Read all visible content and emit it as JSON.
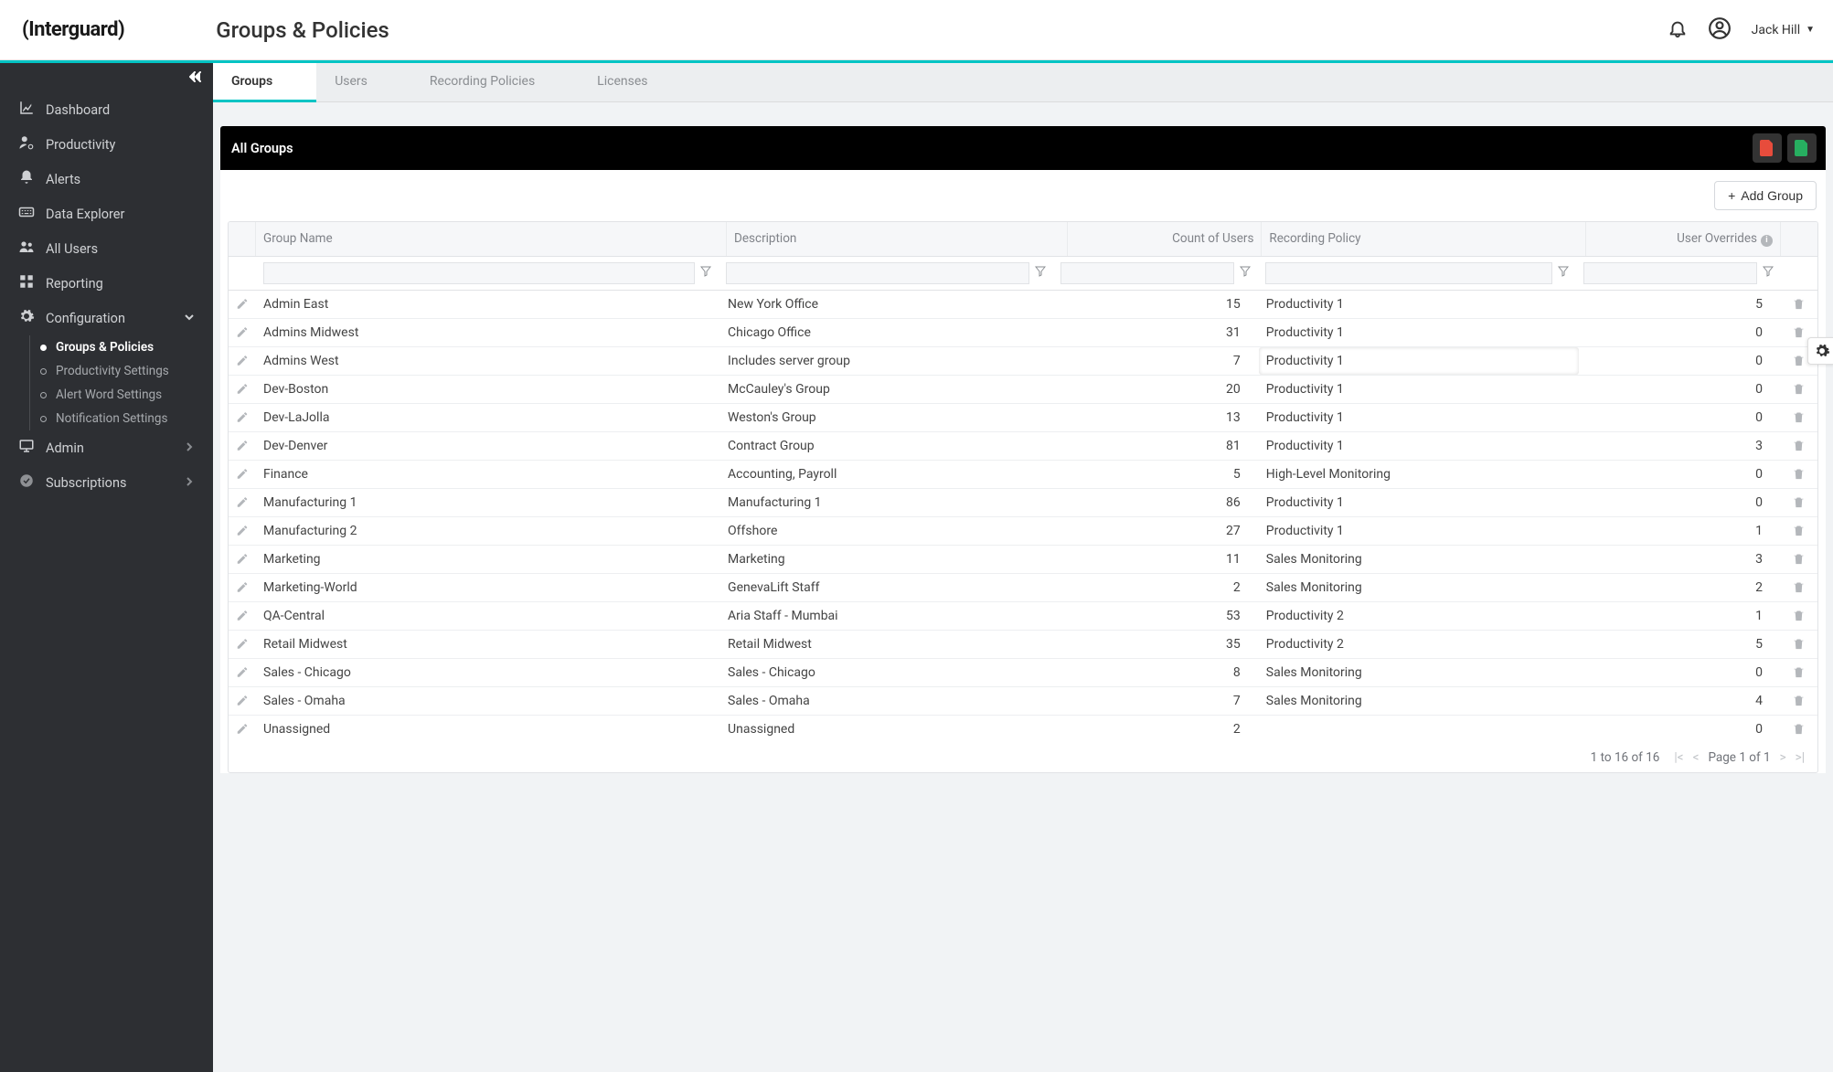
{
  "brand": "(Interguard)",
  "page_title": "Groups & Policies",
  "user_name": "Jack Hill",
  "sidebar": {
    "items": [
      {
        "label": "Dashboard"
      },
      {
        "label": "Productivity"
      },
      {
        "label": "Alerts"
      },
      {
        "label": "Data Explorer"
      },
      {
        "label": "All Users"
      },
      {
        "label": "Reporting"
      },
      {
        "label": "Configuration",
        "expanded": true,
        "children": [
          {
            "label": "Groups & Policies",
            "active": true
          },
          {
            "label": "Productivity Settings"
          },
          {
            "label": "Alert Word Settings"
          },
          {
            "label": "Notification Settings"
          }
        ]
      },
      {
        "label": "Admin"
      },
      {
        "label": "Subscriptions"
      }
    ]
  },
  "tabs": [
    {
      "label": "Groups",
      "active": true
    },
    {
      "label": "Users"
    },
    {
      "label": "Recording Policies"
    },
    {
      "label": "Licenses"
    }
  ],
  "section_title": "All Groups",
  "add_button": "Add Group",
  "columns": {
    "name": "Group Name",
    "desc": "Description",
    "count": "Count of Users",
    "policy": "Recording Policy",
    "overrides": "User Overrides"
  },
  "rows": [
    {
      "name": "Admin East",
      "desc": "New York Office",
      "count": "15",
      "policy": "Productivity 1",
      "over": "5"
    },
    {
      "name": "Admins Midwest",
      "desc": "Chicago Office",
      "count": "31",
      "policy": "Productivity 1",
      "over": "0"
    },
    {
      "name": "Admins West",
      "desc": "Includes server group",
      "count": "7",
      "policy": "Productivity 1",
      "over": "0",
      "editing": true
    },
    {
      "name": "Dev-Boston",
      "desc": "McCauley's Group",
      "count": "20",
      "policy": "Productivity 1",
      "over": "0"
    },
    {
      "name": "Dev-LaJolla",
      "desc": "Weston's Group",
      "count": "13",
      "policy": "Productivity 1",
      "over": "0"
    },
    {
      "name": "Dev-Denver",
      "desc": "Contract Group",
      "count": "81",
      "policy": "Productivity 1",
      "over": "3"
    },
    {
      "name": "Finance",
      "desc": "Accounting, Payroll",
      "count": "5",
      "policy": "High-Level Monitoring",
      "over": "0"
    },
    {
      "name": "Manufacturing 1",
      "desc": "Manufacturing 1",
      "count": "86",
      "policy": "Productivity 1",
      "over": "0"
    },
    {
      "name": "Manufacturing 2",
      "desc": "Offshore",
      "count": "27",
      "policy": "Productivity 1",
      "over": "1"
    },
    {
      "name": "Marketing",
      "desc": "Marketing",
      "count": "11",
      "policy": "Sales Monitoring",
      "over": "3"
    },
    {
      "name": "Marketing-World",
      "desc": "GenevaLift Staff",
      "count": "2",
      "policy": "Sales Monitoring",
      "over": "2"
    },
    {
      "name": "QA-Central",
      "desc": "Aria Staff - Mumbai",
      "count": "53",
      "policy": "Productivity 2",
      "over": "1"
    },
    {
      "name": "Retail Midwest",
      "desc": "Retail Midwest",
      "count": "35",
      "policy": "Productivity 2",
      "over": "5"
    },
    {
      "name": "Sales - Chicago",
      "desc": "Sales - Chicago",
      "count": "8",
      "policy": "Sales Monitoring",
      "over": "0"
    },
    {
      "name": "Sales - Omaha",
      "desc": "Sales - Omaha",
      "count": "7",
      "policy": "Sales Monitoring",
      "over": "4"
    },
    {
      "name": "Unassigned",
      "desc": "Unassigned",
      "count": "2",
      "policy": "",
      "over": "0"
    }
  ],
  "pagination": {
    "range": "1 to 16 of 16",
    "page": "Page 1 of 1"
  }
}
